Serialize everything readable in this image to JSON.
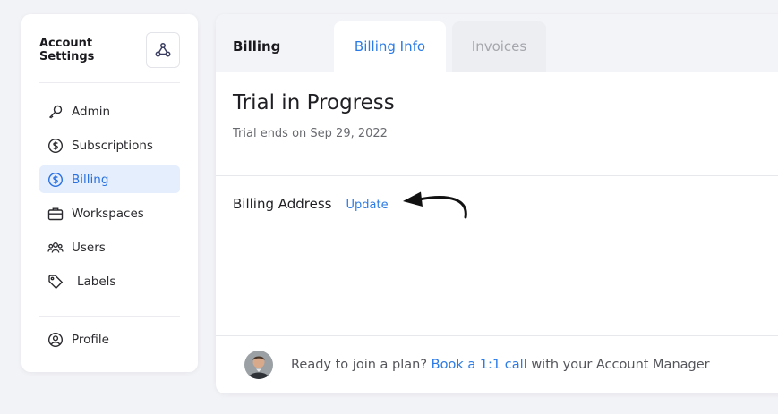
{
  "sidebar": {
    "title": "Account Settings",
    "header_icon": "workflow-nodes-icon",
    "items": [
      {
        "label": "Admin",
        "icon": "key-icon",
        "active": false
      },
      {
        "label": "Subscriptions",
        "icon": "dollar-circle-icon",
        "active": false
      },
      {
        "label": "Billing",
        "icon": "dollar-circle-icon",
        "active": true
      },
      {
        "label": "Workspaces",
        "icon": "briefcase-icon",
        "active": false
      },
      {
        "label": "Users",
        "icon": "users-icon",
        "active": false
      },
      {
        "label": "Labels",
        "icon": "tag-icon",
        "active": false
      }
    ],
    "profile": {
      "label": "Profile",
      "icon": "user-circle-icon"
    }
  },
  "main": {
    "section_title": "Billing",
    "tabs": [
      {
        "label": "Billing Info",
        "active": true
      },
      {
        "label": "Invoices",
        "active": false
      }
    ],
    "trial_title": "Trial in Progress",
    "trial_subtitle": "Trial ends on Sep 29, 2022",
    "billing_address_label": "Billing Address",
    "update_link": "Update"
  },
  "footer": {
    "prefix": "Ready to join a plan?",
    "link": "Book a 1:1 call",
    "suffix": "with your Account Manager"
  },
  "colors": {
    "accent": "#2b7be6",
    "active_bg": "#e4eefc",
    "page_bg": "#f2f3f7"
  }
}
